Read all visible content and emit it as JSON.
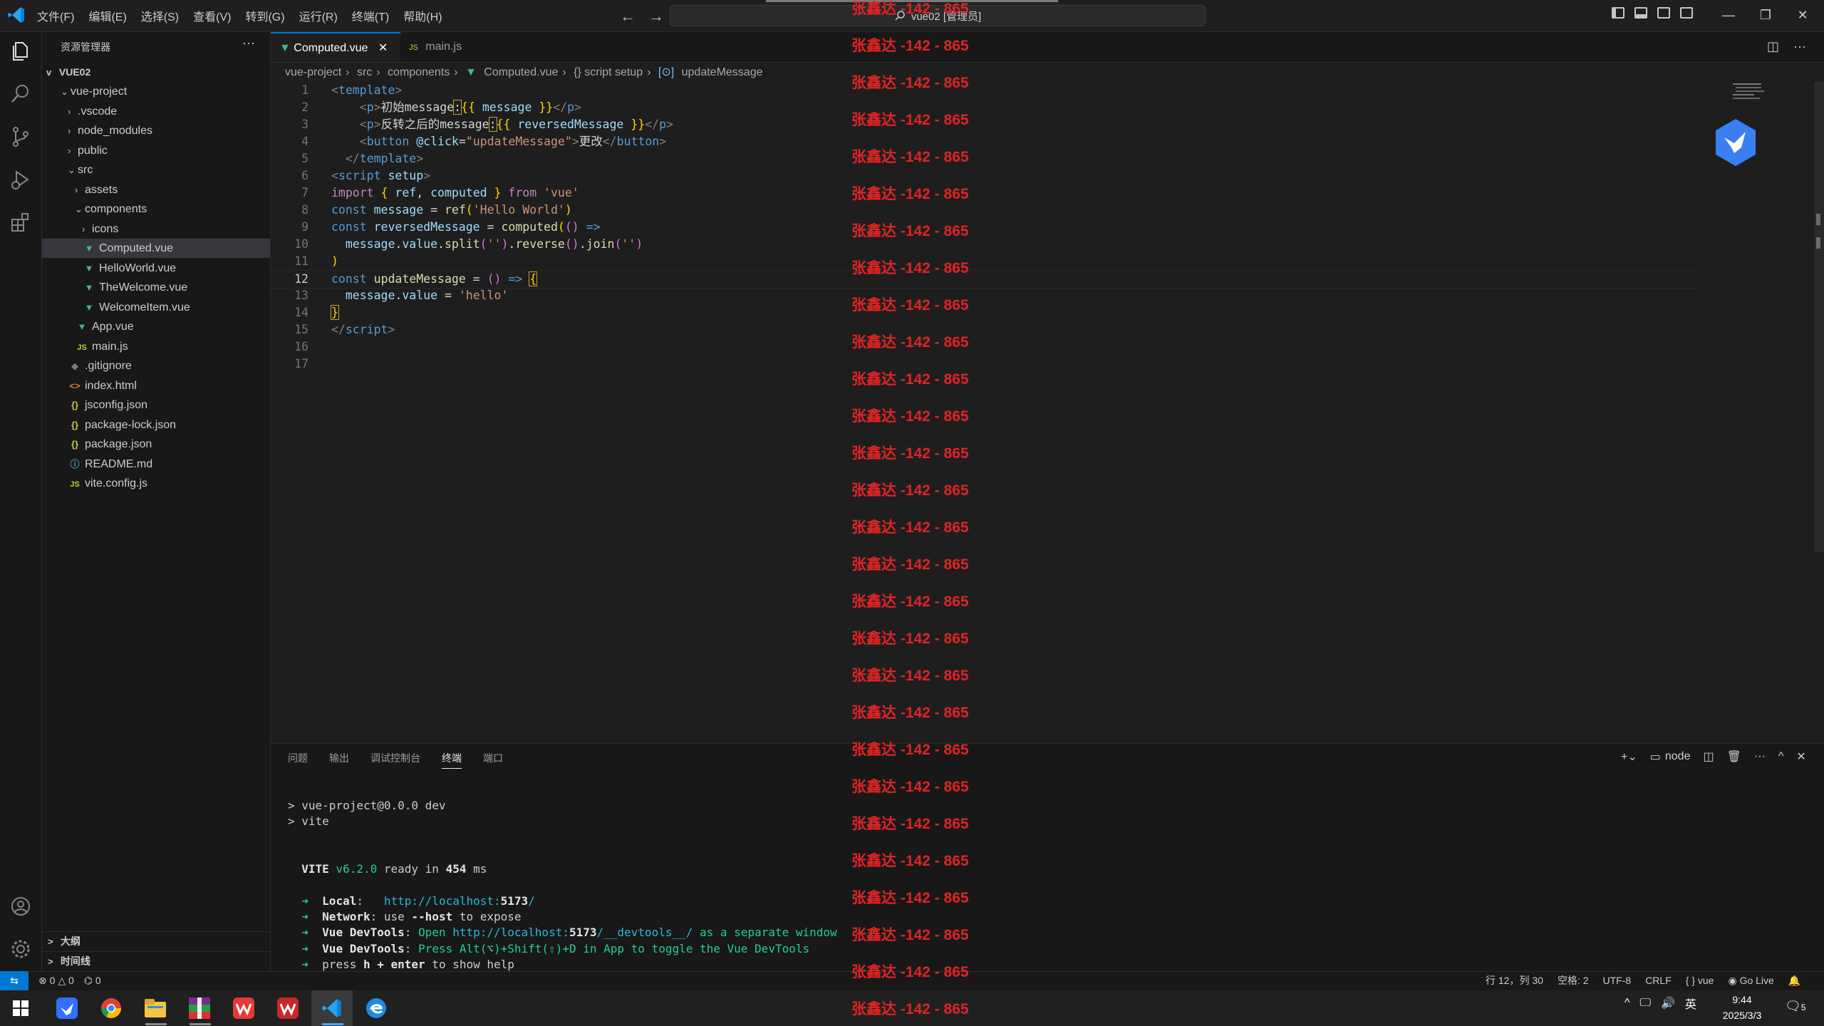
{
  "menu": [
    "文件(F)",
    "编辑(E)",
    "选择(S)",
    "查看(V)",
    "转到(G)",
    "运行(R)",
    "终端(T)",
    "帮助(H)"
  ],
  "command_center": "vue02 [管理员]",
  "sidebar": {
    "title": "资源管理器",
    "root": "VUE02",
    "items": [
      {
        "label": "vue-project",
        "depth": 0,
        "chev": "v",
        "icon": ""
      },
      {
        "label": ".vscode",
        "depth": 1,
        "chev": ">",
        "icon": ""
      },
      {
        "label": "node_modules",
        "depth": 1,
        "chev": ">",
        "icon": ""
      },
      {
        "label": "public",
        "depth": 1,
        "chev": ">",
        "icon": ""
      },
      {
        "label": "src",
        "depth": 1,
        "chev": "v",
        "icon": ""
      },
      {
        "label": "assets",
        "depth": 2,
        "chev": ">",
        "icon": ""
      },
      {
        "label": "components",
        "depth": 2,
        "chev": "v",
        "icon": ""
      },
      {
        "label": "icons",
        "depth": 3,
        "chev": ">",
        "icon": ""
      },
      {
        "label": "Computed.vue",
        "depth": 3,
        "chev": "",
        "icon": "vue",
        "selected": true
      },
      {
        "label": "HelloWorld.vue",
        "depth": 3,
        "chev": "",
        "icon": "vue"
      },
      {
        "label": "TheWelcome.vue",
        "depth": 3,
        "chev": "",
        "icon": "vue"
      },
      {
        "label": "WelcomeItem.vue",
        "depth": 3,
        "chev": "",
        "icon": "vue"
      },
      {
        "label": "App.vue",
        "depth": 2,
        "chev": "",
        "icon": "vue"
      },
      {
        "label": "main.js",
        "depth": 2,
        "chev": "",
        "icon": "js"
      },
      {
        "label": ".gitignore",
        "depth": 1,
        "chev": "",
        "icon": "git"
      },
      {
        "label": "index.html",
        "depth": 1,
        "chev": "",
        "icon": "html"
      },
      {
        "label": "jsconfig.json",
        "depth": 1,
        "chev": "",
        "icon": "json"
      },
      {
        "label": "package-lock.json",
        "depth": 1,
        "chev": "",
        "icon": "json"
      },
      {
        "label": "package.json",
        "depth": 1,
        "chev": "",
        "icon": "json"
      },
      {
        "label": "README.md",
        "depth": 1,
        "chev": "",
        "icon": "info"
      },
      {
        "label": "vite.config.js",
        "depth": 1,
        "chev": "",
        "icon": "js"
      }
    ],
    "outline": "大纲",
    "timeline": "时间线"
  },
  "tabs": [
    {
      "label": "Computed.vue",
      "icon": "vue",
      "active": true
    },
    {
      "label": "main.js",
      "icon": "js",
      "active": false
    }
  ],
  "breadcrumb": [
    "vue-project",
    "src",
    "components",
    "Computed.vue",
    "{} script setup",
    "updateMessage"
  ],
  "code_lines": [
    [
      [
        "t-br",
        "<"
      ],
      [
        "t-tag",
        "template"
      ],
      [
        "t-br",
        ">"
      ]
    ],
    [
      [
        "t-txt",
        "    "
      ],
      [
        "t-br",
        "<"
      ],
      [
        "t-tag",
        "p"
      ],
      [
        "t-br",
        ">"
      ],
      [
        "t-txt",
        "初始message"
      ],
      [
        "t-txt hl-box",
        ":"
      ],
      [
        "t-gold",
        "{{"
      ],
      [
        "t-var",
        " message "
      ],
      [
        "t-gold",
        "}}"
      ],
      [
        "t-br",
        "</"
      ],
      [
        "t-tag",
        "p"
      ],
      [
        "t-br",
        ">"
      ]
    ],
    [
      [
        "t-txt",
        "    "
      ],
      [
        "t-br",
        "<"
      ],
      [
        "t-tag",
        "p"
      ],
      [
        "t-br",
        ">"
      ],
      [
        "t-txt",
        "反转之后的message"
      ],
      [
        "t-txt hl-box",
        ":"
      ],
      [
        "t-gold",
        "{{"
      ],
      [
        "t-var",
        " reversedMessage "
      ],
      [
        "t-gold",
        "}}"
      ],
      [
        "t-br",
        "</"
      ],
      [
        "t-tag",
        "p"
      ],
      [
        "t-br",
        ">"
      ]
    ],
    [
      [
        "t-txt",
        "    "
      ],
      [
        "t-br",
        "<"
      ],
      [
        "t-tag",
        "button"
      ],
      [
        "t-attr",
        " @click"
      ],
      [
        "t-txt",
        "="
      ],
      [
        "t-str",
        "\"updateMessage\""
      ],
      [
        "t-br",
        ">"
      ],
      [
        "t-txt",
        "更改"
      ],
      [
        "t-br",
        "</"
      ],
      [
        "t-tag",
        "button"
      ],
      [
        "t-br",
        ">"
      ]
    ],
    [
      [
        "t-txt",
        "  "
      ],
      [
        "t-br",
        "</"
      ],
      [
        "t-tag",
        "template"
      ],
      [
        "t-br",
        ">"
      ]
    ],
    [
      [
        "t-br",
        "<"
      ],
      [
        "t-tag",
        "script"
      ],
      [
        "t-attr",
        " setup"
      ],
      [
        "t-br",
        ">"
      ]
    ],
    [
      [
        "t-kw2",
        "import"
      ],
      [
        "t-txt",
        " "
      ],
      [
        "t-gold",
        "{"
      ],
      [
        "t-var",
        " ref"
      ],
      [
        "t-txt",
        ","
      ],
      [
        "t-var",
        " computed "
      ],
      [
        "t-gold",
        "}"
      ],
      [
        "t-kw2",
        " from"
      ],
      [
        "t-str",
        " 'vue'"
      ]
    ],
    [
      [
        "t-kw",
        "const"
      ],
      [
        "t-var",
        " message"
      ],
      [
        "t-txt",
        " = "
      ],
      [
        "t-fn",
        "ref"
      ],
      [
        "t-gold",
        "("
      ],
      [
        "t-str",
        "'Hello World'"
      ],
      [
        "t-gold",
        ")"
      ]
    ],
    [
      [
        "t-kw",
        "const"
      ],
      [
        "t-var",
        " reversedMessage"
      ],
      [
        "t-txt",
        " = "
      ],
      [
        "t-fn",
        "computed"
      ],
      [
        "t-gold",
        "("
      ],
      [
        "t-pink",
        "()"
      ],
      [
        "t-kw",
        " =>"
      ]
    ],
    [
      [
        "t-txt",
        "  "
      ],
      [
        "t-var",
        "message"
      ],
      [
        "t-txt",
        "."
      ],
      [
        "t-var",
        "value"
      ],
      [
        "t-txt",
        "."
      ],
      [
        "t-fn",
        "split"
      ],
      [
        "t-pink",
        "("
      ],
      [
        "t-str",
        "''"
      ],
      [
        "t-pink",
        ")"
      ],
      [
        "t-txt",
        "."
      ],
      [
        "t-fn",
        "reverse"
      ],
      [
        "t-pink",
        "()"
      ],
      [
        "t-txt",
        "."
      ],
      [
        "t-fn",
        "join"
      ],
      [
        "t-pink",
        "("
      ],
      [
        "t-str",
        "''"
      ],
      [
        "t-pink",
        ")"
      ]
    ],
    [
      [
        "t-gold",
        ")"
      ]
    ],
    [
      [
        "t-kw",
        "const"
      ],
      [
        "t-fn",
        " updateMessage"
      ],
      [
        "t-txt",
        " = "
      ],
      [
        "t-pink",
        "()"
      ],
      [
        "t-kw",
        " =>"
      ],
      [
        "t-txt",
        " "
      ],
      [
        "t-gold hl-box",
        "{"
      ]
    ],
    [
      [
        "t-txt",
        "  "
      ],
      [
        "t-var",
        "message"
      ],
      [
        "t-txt",
        "."
      ],
      [
        "t-var",
        "value"
      ],
      [
        "t-txt",
        " = "
      ],
      [
        "t-str",
        "'hello'"
      ]
    ],
    [
      [
        "t-gold hl-box",
        "}"
      ]
    ],
    [
      [
        "t-br",
        "</"
      ],
      [
        "t-tag",
        "script"
      ],
      [
        "t-br",
        ">"
      ]
    ],
    [],
    []
  ],
  "current_line": 12,
  "panel": {
    "tabs": [
      "问题",
      "输出",
      "调试控制台",
      "终端",
      "端口"
    ],
    "active_tab": 3,
    "node_label": "node"
  },
  "terminal": [
    [
      [
        "",
        "> vue-project@0.0.0 dev"
      ]
    ],
    [
      [
        "",
        "> vite"
      ]
    ],
    [],
    [],
    [
      [
        "g bold",
        "  VITE "
      ],
      [
        "g",
        "v6.2.0"
      ],
      [
        "",
        " ready in "
      ],
      [
        "bold",
        "454"
      ],
      [
        "",
        " ms"
      ]
    ],
    [],
    [
      [
        "g",
        "  ➜  "
      ],
      [
        "bold",
        "Local"
      ],
      [
        "",
        ":   "
      ],
      [
        "c",
        "http://localhost:"
      ],
      [
        "c bold",
        "5173"
      ],
      [
        "c",
        "/"
      ]
    ],
    [
      [
        "g",
        "  ➜  "
      ],
      [
        "bold",
        "Network"
      ],
      [
        "",
        ": use "
      ],
      [
        "bold",
        "--host"
      ],
      [
        "",
        " to expose"
      ]
    ],
    [
      [
        "g",
        "  ➜  "
      ],
      [
        "bold",
        "Vue DevTools"
      ],
      [
        "",
        ": "
      ],
      [
        "g",
        "Open "
      ],
      [
        "c",
        "http://localhost:"
      ],
      [
        "c bold",
        "5173"
      ],
      [
        "c",
        "/__devtools__/"
      ],
      [
        "g",
        " as a separate window"
      ]
    ],
    [
      [
        "g",
        "  ➜  "
      ],
      [
        "bold",
        "Vue DevTools"
      ],
      [
        "",
        ": "
      ],
      [
        "g",
        "Press "
      ],
      [
        "g",
        "Alt(⌥)+Shift(⇧)+D"
      ],
      [
        "g",
        " in App to toggle the Vue DevTools"
      ]
    ],
    [
      [
        "g",
        "  ➜  "
      ],
      [
        "",
        "press "
      ],
      [
        "bold",
        "h + enter"
      ],
      [
        "",
        " to show help"
      ]
    ]
  ],
  "status": {
    "errors": "0",
    "warnings": "0",
    "ports": "0",
    "position": "行 12，列 30",
    "spaces": "空格: 2",
    "encoding": "UTF-8",
    "eol": "CRLF",
    "language": "vue",
    "golive": "Go Live"
  },
  "taskbar": {
    "time": "9:44",
    "date": "2025/3/3",
    "ime": "英",
    "notif_count": "5"
  },
  "watermark": "张鑫达 -142 - 865",
  "colors": {
    "accent": "#0078d4",
    "vue": "#41b883",
    "watermark": "#e02424"
  }
}
